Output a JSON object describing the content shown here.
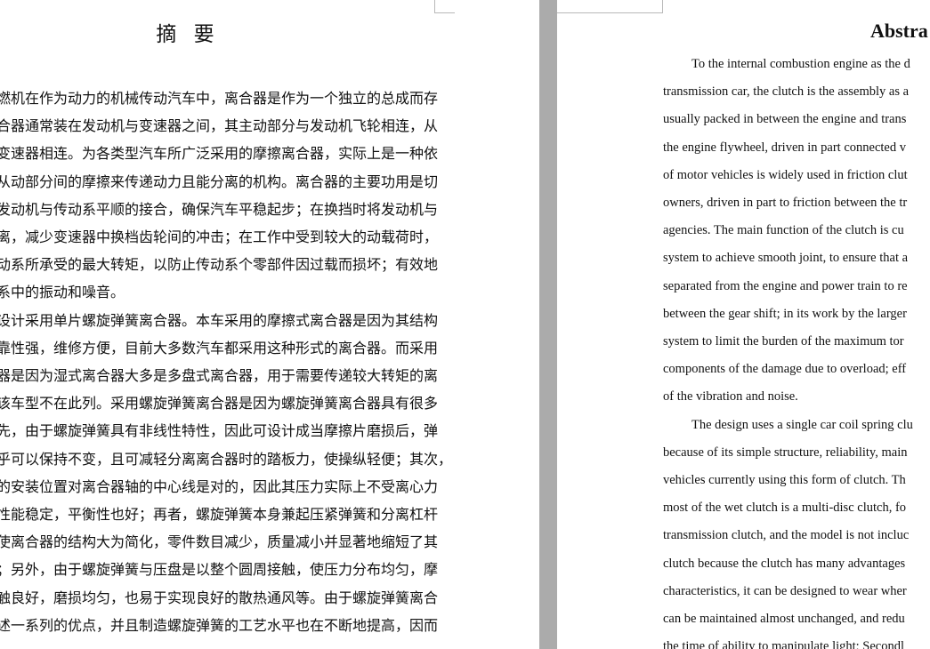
{
  "left_page": {
    "title": "摘 要",
    "lines": [
      "燃机在作为动力的机械传动汽车中，离合器是作为一个独立的总成而存",
      "合器通常装在发动机与变速器之间，其主动部分与发动机飞轮相连，从",
      "变速器相连。为各类型汽车所广泛采用的摩擦离合器，实际上是一种依",
      "从动部分间的摩擦来传递动力且能分离的机构。离合器的主要功用是切",
      "发动机与传动系平顺的接合，确保汽车平稳起步；在换挡时将发动机与",
      "离，减少变速器中换档齿轮间的冲击；在工作中受到较大的动载荷时，",
      "动系所承受的最大转矩，以防止传动系个零部件因过载而损坏；有效地",
      "系中的振动和噪音。",
      "设计采用单片螺旋弹簧离合器。本车采用的摩擦式离合器是因为其结构",
      "靠性强，维修方便，目前大多数汽车都采用这种形式的离合器。而采用",
      "器是因为湿式离合器大多是多盘式离合器，用于需要传递较大转矩的离",
      "该车型不在此列。采用螺旋弹簧离合器是因为螺旋弹簧离合器具有很多",
      "先，由于螺旋弹簧具有非线性特性，因此可设计成当摩擦片磨损后，弹",
      "乎可以保持不变，且可减轻分离离合器时的踏板力，使操纵轻便；其次，",
      "的安装位置对离合器轴的中心线是对的，因此其压力实际上不受离心力",
      "性能稳定，平衡性也好；再者，螺旋弹簧本身兼起压紧弹簧和分离杠杆",
      "使离合器的结构大为简化，零件数目减少，质量减小并显著地缩短了其",
      "；另外，由于螺旋弹簧与压盘是以整个圆周接触，使压力分布均匀，摩",
      "触良好，磨损均匀，也易于实现良好的散热通风等。由于螺旋弹簧离合",
      "述一系列的优点，并且制造螺旋弹簧的工艺水平也在不断地提高，因而"
    ]
  },
  "right_page": {
    "title": "Abstra",
    "lines": [
      "To the internal combustion engine as the d",
      "transmission car, the clutch is the assembly as a",
      "usually packed in between the engine and trans",
      "the engine flywheel, driven in part connected v",
      "of motor vehicles is widely used in friction clut",
      "owners, driven in part to friction between the tr",
      "agencies. The main function of the clutch is cu",
      "system to achieve smooth joint, to ensure that a",
      "separated from the engine and power train to re",
      "between the gear shift; in its work by the larger",
      "system to limit the burden of the maximum tor",
      "components of the damage due to overload; eff",
      "of the vibration and noise.",
      "The design uses a single car coil spring clu",
      "because of its simple structure, reliability, main",
      "vehicles currently using this form of clutch. Th",
      "most of the wet clutch is a multi-disc clutch, fo",
      "transmission clutch, and the model is not incluc",
      "clutch because the clutch has many advantages",
      "characteristics, it can be designed to wear wher",
      "can be maintained almost unchanged, and redu",
      "the time of ability to manipulate light; Secondl"
    ]
  }
}
